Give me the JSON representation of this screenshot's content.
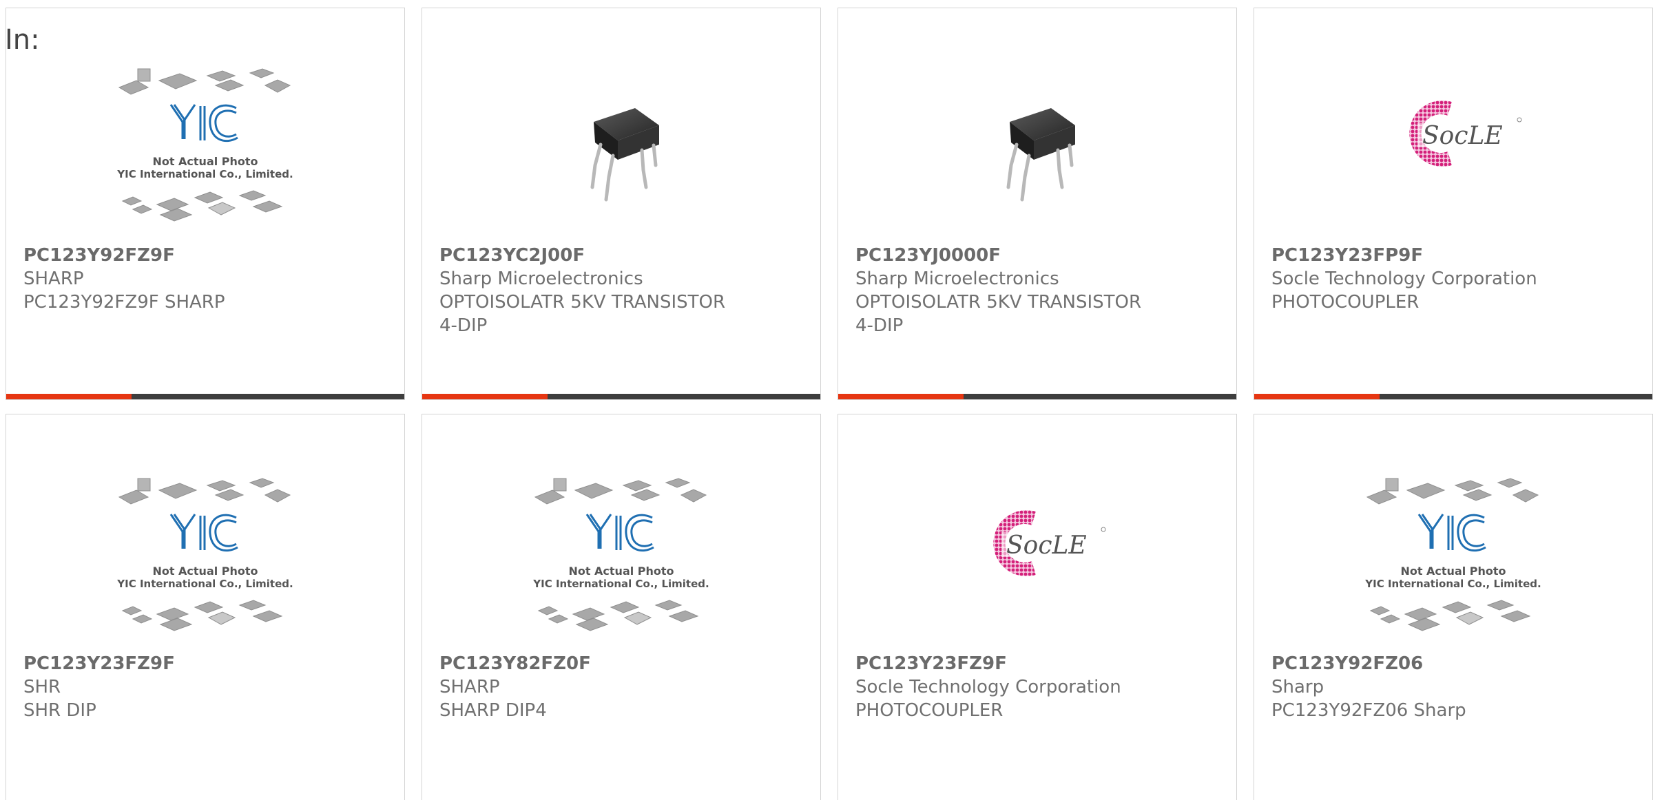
{
  "page": {
    "in_label": "In:"
  },
  "placeholder_image": {
    "caption_line1": "Not Actual Photo",
    "caption_line2": "YIC International Co., Limited.",
    "logo_text": "YIC"
  },
  "socle_image": {
    "logo_text": "SocLE"
  },
  "colors": {
    "accent": "#e63612",
    "bar": "#3e3e3e",
    "border": "#d4d4d4",
    "text": "#707070"
  },
  "products": [
    {
      "part": "PC123Y92FZ9F",
      "manufacturer": "SHARP",
      "desc1": "PC123Y92FZ9F SHARP",
      "desc2": "",
      "image": "yic-placeholder"
    },
    {
      "part": "PC123YC2J00F",
      "manufacturer": "Sharp Microelectronics",
      "desc1": "OPTOISOLATR 5KV TRANSISTOR",
      "desc2": "4-DIP",
      "image": "dip4-chip"
    },
    {
      "part": "PC123YJ0000F",
      "manufacturer": "Sharp Microelectronics",
      "desc1": "OPTOISOLATR 5KV TRANSISTOR",
      "desc2": "4-DIP",
      "image": "dip4-chip"
    },
    {
      "part": "PC123Y23FP9F",
      "manufacturer": "Socle Technology Corporation",
      "desc1": "PHOTOCOUPLER",
      "desc2": "",
      "image": "socle-logo"
    },
    {
      "part": "PC123Y23FZ9F",
      "manufacturer": "SHR",
      "desc1": "SHR DIP",
      "desc2": "",
      "image": "yic-placeholder"
    },
    {
      "part": "PC123Y82FZ0F",
      "manufacturer": "SHARP",
      "desc1": "SHARP DIP4",
      "desc2": "",
      "image": "yic-placeholder"
    },
    {
      "part": "PC123Y23FZ9F",
      "manufacturer": "Socle Technology Corporation",
      "desc1": "PHOTOCOUPLER",
      "desc2": "",
      "image": "socle-logo"
    },
    {
      "part": "PC123Y92FZ06",
      "manufacturer": "Sharp",
      "desc1": "PC123Y92FZ06 Sharp",
      "desc2": "",
      "image": "yic-placeholder"
    }
  ]
}
